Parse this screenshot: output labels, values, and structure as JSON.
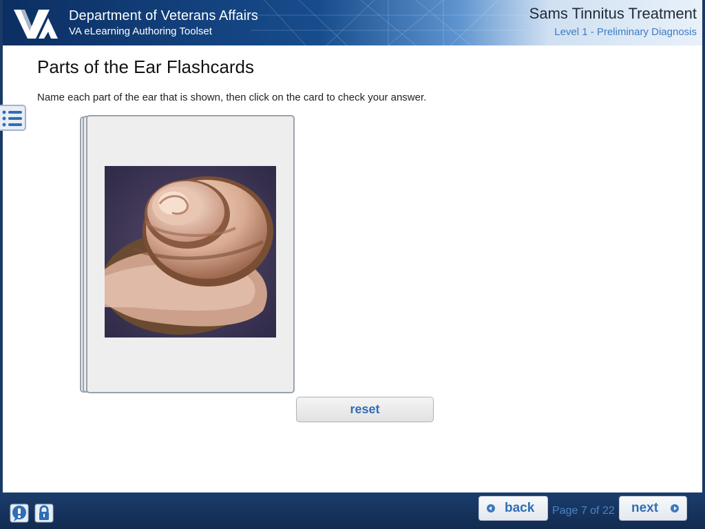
{
  "header": {
    "org_title": "Department of Veterans Affairs",
    "org_subtitle": "VA eLearning Authoring Toolset",
    "logo_icon": "va-logo-icon",
    "course_title": "Sams Tinnitus Treatment",
    "course_level": "Level 1 - Preliminary Diagnosis"
  },
  "main": {
    "page_title": "Parts of the Ear Flashcards",
    "instructions": "Name each part of the ear that is shown, then click on the card to check your answer.",
    "menu_icon": "list-menu-icon",
    "flashcard": {
      "image_icon": "cochlea-image"
    },
    "reset_label": "reset"
  },
  "footer": {
    "help_icon": "help-icon",
    "lock_icon": "lock-icon",
    "back_label": "back",
    "next_label": "next",
    "page_indicator": "Page 7 of 22"
  },
  "colors": {
    "brand_dark": "#1b3a66",
    "accent_blue": "#2f6fb5",
    "card_bg": "#eeeeee"
  }
}
